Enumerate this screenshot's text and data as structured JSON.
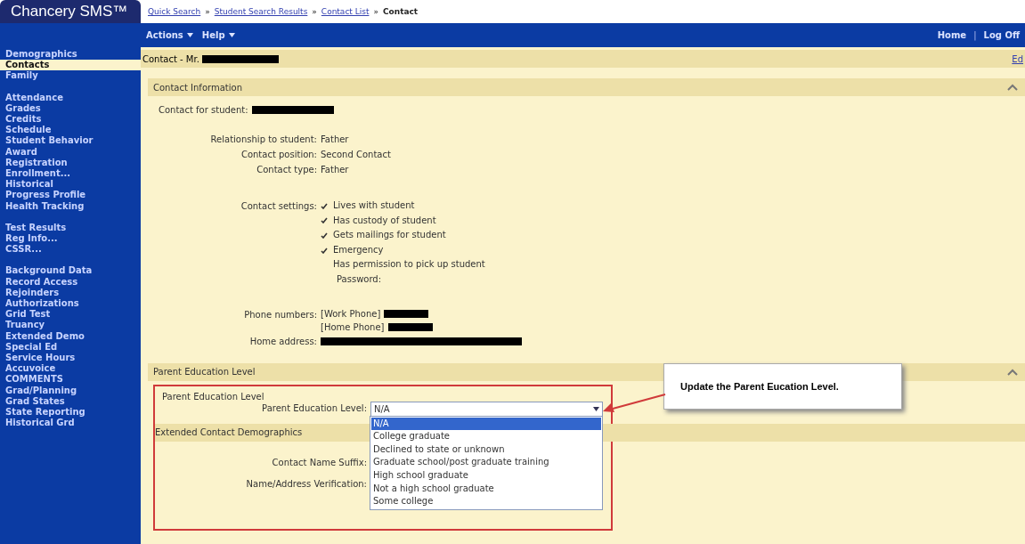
{
  "app": {
    "logo": "Chancery SMS™"
  },
  "breadcrumbs": [
    {
      "kind": "link",
      "label": "Quick Search"
    },
    {
      "kind": "separator",
      "label": "»"
    },
    {
      "kind": "link",
      "label": "Student Search Results"
    },
    {
      "kind": "separator",
      "label": "»"
    },
    {
      "kind": "link",
      "label": "Contact List"
    },
    {
      "kind": "separator",
      "label": "»"
    },
    {
      "kind": "current",
      "label": "Contact"
    }
  ],
  "menu_bar": {
    "menus": [
      "Actions",
      "Help"
    ],
    "links": [
      {
        "kind": "link",
        "label": "Home"
      },
      {
        "kind": "separator",
        "label": "|"
      },
      {
        "kind": "link",
        "label": "Log Off"
      }
    ]
  },
  "sidebar": {
    "groups": [
      [
        {
          "label": "Demographics",
          "selected": false
        },
        {
          "label": "Contacts",
          "selected": true
        },
        {
          "label": "Family",
          "selected": false
        }
      ],
      [
        {
          "label": "Attendance",
          "selected": false
        },
        {
          "label": "Grades",
          "selected": false
        },
        {
          "label": "Credits",
          "selected": false
        },
        {
          "label": "Schedule",
          "selected": false
        },
        {
          "label": "Student Behavior",
          "selected": false
        },
        {
          "label": "Award",
          "selected": false
        },
        {
          "label": "Registration",
          "selected": false
        },
        {
          "label": "Enrollment...",
          "selected": false
        },
        {
          "label": "Historical",
          "selected": false
        },
        {
          "label": "Progress Profile",
          "selected": false
        },
        {
          "label": "Health Tracking",
          "selected": false
        }
      ],
      [
        {
          "label": "Test Results",
          "selected": false
        },
        {
          "label": "Reg Info...",
          "selected": false
        },
        {
          "label": "CSSR...",
          "selected": false
        }
      ],
      [
        {
          "label": "Background Data",
          "selected": false
        },
        {
          "label": "Record Access",
          "selected": false
        },
        {
          "label": "Rejoinders",
          "selected": false
        },
        {
          "label": "Authorizations",
          "selected": false
        },
        {
          "label": "Grid Test",
          "selected": false
        },
        {
          "label": "Truancy",
          "selected": false
        },
        {
          "label": "Extended Demo",
          "selected": false
        },
        {
          "label": "Special Ed",
          "selected": false
        },
        {
          "label": "Service Hours",
          "selected": false
        },
        {
          "label": "Accuvoice",
          "selected": false
        },
        {
          "label": "COMMENTS",
          "selected": false
        },
        {
          "label": "Grad/Planning",
          "selected": false
        },
        {
          "label": "Grad States",
          "selected": false
        },
        {
          "label": "State Reporting",
          "selected": false
        },
        {
          "label": "Historical Grd",
          "selected": false
        }
      ]
    ]
  },
  "contact_header": {
    "title": "Contact - Mr.",
    "edit_link": "Ed"
  },
  "contact_information": {
    "title": "Contact Information",
    "contact_for_student": "Contact for student:",
    "details": [
      {
        "label": "Relationship to student:",
        "value": "Father"
      },
      {
        "label": "Contact position:",
        "value": "Second Contact"
      },
      {
        "label": "Contact type:",
        "value": "Father"
      }
    ],
    "settings_label": "Contact settings:",
    "settings": [
      {
        "kind": "check",
        "label": "Lives with student",
        "checked": true
      },
      {
        "kind": "check",
        "label": "Has custody of student",
        "checked": true
      },
      {
        "kind": "check",
        "label": "Gets mailings for student",
        "checked": true
      },
      {
        "kind": "check",
        "label": "Emergency",
        "checked": true
      },
      {
        "kind": "check",
        "label": "Has permission to pick up student",
        "checked": false
      },
      {
        "kind": "text",
        "label": "Password:"
      }
    ],
    "phone_label": "Phone numbers:",
    "phones": [
      "[Work Phone]",
      "[Home Phone]"
    ],
    "address_label": "Home address:"
  },
  "parent_education": {
    "title": "Parent Education Level",
    "subtitle": "Parent Education Level",
    "field_label": "Parent Education Level:",
    "value": "N/A",
    "options": [
      {
        "label": "N/A",
        "selected": true
      },
      {
        "label": "College graduate",
        "selected": false
      },
      {
        "label": "Declined to state or unknown",
        "selected": false
      },
      {
        "label": "Graduate school/post graduate training",
        "selected": false
      },
      {
        "label": "High school graduate",
        "selected": false
      },
      {
        "label": "Not a high school graduate",
        "selected": false
      },
      {
        "label": "Some college",
        "selected": false
      }
    ]
  },
  "extended_demographics": {
    "title": "Extended Contact Demographics",
    "fields": [
      "Contact Name Suffix:",
      "Name/Address Verification:"
    ]
  },
  "callout": {
    "text": "Update the Parent Eucation Level."
  }
}
